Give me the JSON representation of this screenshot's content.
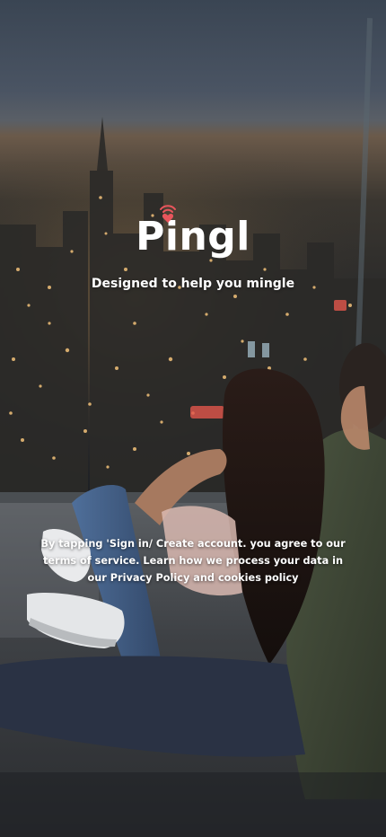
{
  "app": {
    "title": "Pingl",
    "tagline": "Designed to help you mingle"
  },
  "legal": {
    "text": "By tapping 'Sign in/ Create account. you agree to our terms of service. Learn how we process your data in our Privacy Policy and cookies policy"
  },
  "icons": {
    "logo_icon": "heart-signal-icon"
  },
  "colors": {
    "accent": "#e8555c",
    "text": "#ffffff",
    "sky": "#3c4756"
  }
}
